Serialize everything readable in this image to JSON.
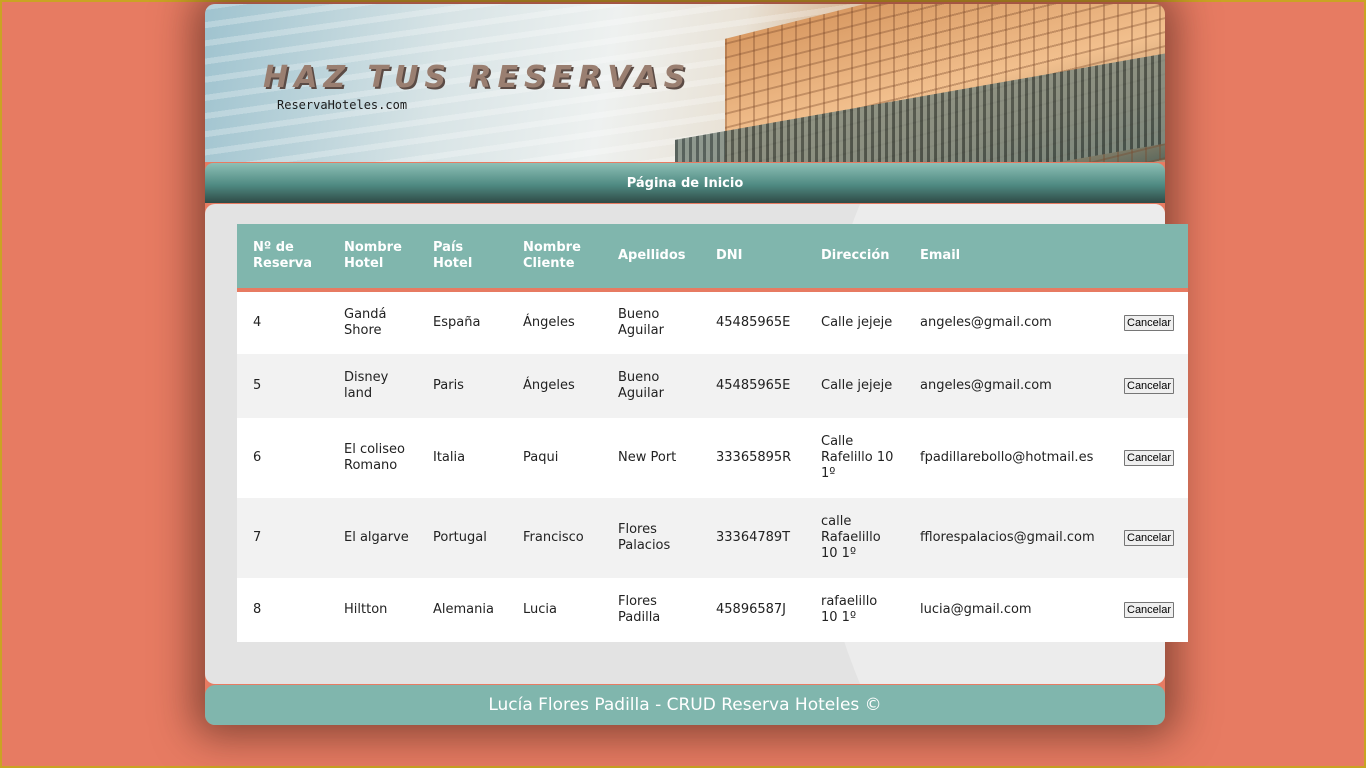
{
  "banner": {
    "title": "HAZ TUS RESERVAS",
    "subtitle": "ReservaHoteles.com"
  },
  "nav": {
    "home_link": "Página de Inicio"
  },
  "table": {
    "headers": [
      "Nº de Reserva",
      "Nombre Hotel",
      "País Hotel",
      "Nombre Cliente",
      "Apellidos",
      "DNI",
      "Dirección",
      "Email",
      ""
    ],
    "rows": [
      {
        "id": "4",
        "hotel": "Gandá Shore",
        "pais": "España",
        "cliente": "Ángeles",
        "apellidos": "Bueno Aguilar",
        "dni": "45485965E",
        "direccion": "Calle jejeje",
        "email": "angeles@gmail.com",
        "action": "Cancelar"
      },
      {
        "id": "5",
        "hotel": "Disney land",
        "pais": "Paris",
        "cliente": "Ángeles",
        "apellidos": "Bueno Aguilar",
        "dni": "45485965E",
        "direccion": "Calle jejeje",
        "email": "angeles@gmail.com",
        "action": "Cancelar"
      },
      {
        "id": "6",
        "hotel": "El coliseo Romano",
        "pais": "Italia",
        "cliente": "Paqui",
        "apellidos": "New Port",
        "dni": "33365895R",
        "direccion": "Calle Rafelillo 10 1º",
        "email": "fpadillarebollo@hotmail.es",
        "action": "Cancelar"
      },
      {
        "id": "7",
        "hotel": "El algarve",
        "pais": "Portugal",
        "cliente": "Francisco",
        "apellidos": "Flores Palacios",
        "dni": "33364789T",
        "direccion": "calle Rafaelillo 10 1º",
        "email": "fflorespalacios@gmail.com",
        "action": "Cancelar"
      },
      {
        "id": "8",
        "hotel": "Hiltton",
        "pais": "Alemania",
        "cliente": "Lucia",
        "apellidos": "Flores Padilla",
        "dni": "45896587J",
        "direccion": "rafaelillo 10 1º",
        "email": "lucia@gmail.com",
        "action": "Cancelar"
      }
    ]
  },
  "footer": {
    "text": "Lucía Flores Padilla - CRUD Reserva Hoteles ©"
  },
  "colors": {
    "background": "#e77b62",
    "accent": "#80b6ad",
    "header_underline": "#e77b62",
    "body_border": "#caa323"
  }
}
